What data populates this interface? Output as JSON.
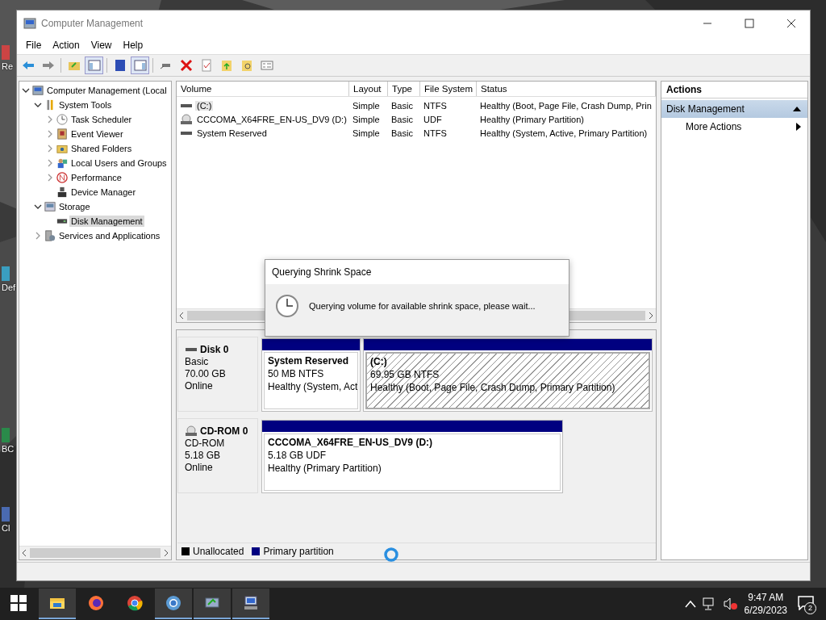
{
  "desktop_icons": [
    {
      "label": "Re"
    },
    {
      "label": "Def"
    },
    {
      "label": "BC"
    },
    {
      "label": "Cl"
    }
  ],
  "window": {
    "title": "Computer Management"
  },
  "menu": [
    "File",
    "Action",
    "View",
    "Help"
  ],
  "tree": [
    {
      "label": "Computer Management (Local",
      "expanded": true,
      "children": [
        {
          "label": "System Tools",
          "expanded": true,
          "children": [
            {
              "label": "Task Scheduler",
              "expanded": false
            },
            {
              "label": "Event Viewer",
              "expanded": false
            },
            {
              "label": "Shared Folders",
              "expanded": false
            },
            {
              "label": "Local Users and Groups",
              "expanded": false
            },
            {
              "label": "Performance",
              "expanded": false
            },
            {
              "label": "Device Manager",
              "selected": false
            }
          ]
        },
        {
          "label": "Storage",
          "expanded": true,
          "children": [
            {
              "label": "Disk Management",
              "selected": true
            }
          ]
        },
        {
          "label": "Services and Applications",
          "expanded": false
        }
      ]
    }
  ],
  "volume_table": {
    "columns": [
      "Volume",
      "Layout",
      "Type",
      "File System",
      "Status"
    ],
    "rows": [
      {
        "kind": "disk",
        "selected": true,
        "cells": [
          "(C:)",
          "Simple",
          "Basic",
          "NTFS",
          "Healthy (Boot, Page File, Crash Dump, Prin"
        ]
      },
      {
        "kind": "cdrom",
        "selected": false,
        "cells": [
          "CCCOMA_X64FRE_EN-US_DV9 (D:)",
          "Simple",
          "Basic",
          "UDF",
          "Healthy (Primary Partition)"
        ]
      },
      {
        "kind": "disk",
        "selected": false,
        "cells": [
          "System Reserved",
          "Simple",
          "Basic",
          "NTFS",
          "Healthy (System, Active, Primary Partition)"
        ]
      }
    ]
  },
  "dialog": {
    "title": "Querying Shrink Space",
    "message": "Querying volume for available shrink space, please wait..."
  },
  "disks": [
    {
      "kind": "disk",
      "name": "Disk 0",
      "lines": [
        "Basic",
        "70.00 GB",
        "Online"
      ],
      "partitions": [
        {
          "name": "System Reserved",
          "size": "50 MB NTFS",
          "status": "Healthy (System, Act",
          "selected": false
        },
        {
          "name": "(C:)",
          "size": "69.95 GB NTFS",
          "status": "Healthy (Boot, Page File, Crash Dump, Primary Partition)",
          "selected": true
        }
      ]
    },
    {
      "kind": "cdrom",
      "name": "CD-ROM 0",
      "lines": [
        "CD-ROM",
        "5.18 GB",
        "Online"
      ],
      "partitions": [
        {
          "name": "CCCOMA_X64FRE_EN-US_DV9  (D:)",
          "size": "5.18 GB UDF",
          "status": "Healthy (Primary Partition)",
          "selected": false
        }
      ]
    }
  ],
  "legend": [
    {
      "label": "Unallocated",
      "color": "#000000"
    },
    {
      "label": "Primary partition",
      "color": "#000080"
    }
  ],
  "actions": {
    "title": "Actions",
    "section": {
      "label": "Disk Management",
      "expanded": true
    },
    "items": [
      {
        "label": "More Actions"
      }
    ]
  },
  "taskbar": {
    "apps": [
      {
        "active": true
      },
      {
        "active": false
      },
      {
        "active": false
      },
      {
        "active": true
      },
      {
        "active": true
      },
      {
        "active": true
      }
    ],
    "time": "9:47 AM",
    "date": "6/29/2023",
    "notifications": "2"
  }
}
